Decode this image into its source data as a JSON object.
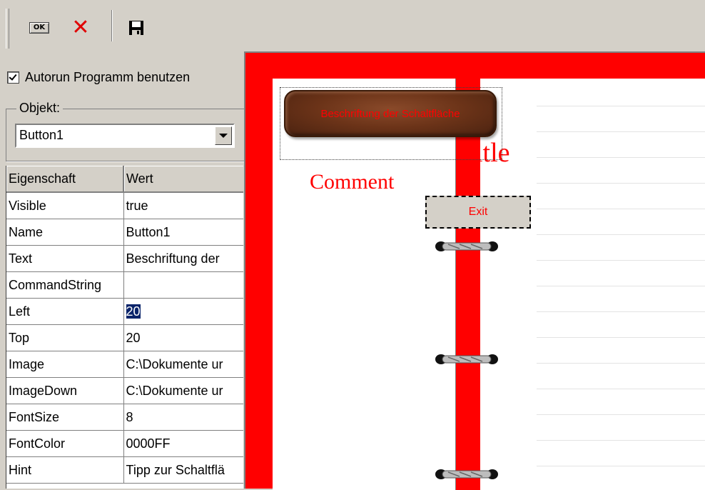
{
  "toolbar": {
    "ok_icon_text": "OK",
    "buttons": [
      "ok-icon",
      "close-icon",
      "save-icon"
    ],
    "colors": {
      "close": "#e00000",
      "save": "#000000"
    }
  },
  "panel": {
    "autorun_label": "Autorun Programm benutzen",
    "autorun_checked": true,
    "object_group_label": "Objekt:",
    "object_selected": "Button1",
    "grid": {
      "headers": [
        "Eigenschaft",
        "Wert"
      ],
      "rows": [
        [
          "Visible",
          "true"
        ],
        [
          "Name",
          "Button1"
        ],
        [
          "Text",
          "Beschriftung der"
        ],
        [
          "CommandString",
          ""
        ],
        [
          "Left",
          "20"
        ],
        [
          "Top",
          "20"
        ],
        [
          "Image",
          "C:\\Dokumente ur"
        ],
        [
          "ImageDown",
          "C:\\Dokumente ur"
        ],
        [
          "FontSize",
          "8"
        ],
        [
          "FontColor",
          "0000FF"
        ],
        [
          "Hint",
          "Tipp zur Schaltflä"
        ]
      ]
    }
  },
  "canvas": {
    "button1_label": "Beschriftung der Schaltfläche",
    "title_text": "itle",
    "comment_text": "Comment",
    "exit_label": "Exit",
    "colors": {
      "frame": "#ff0000",
      "text": "#ff0000"
    }
  }
}
